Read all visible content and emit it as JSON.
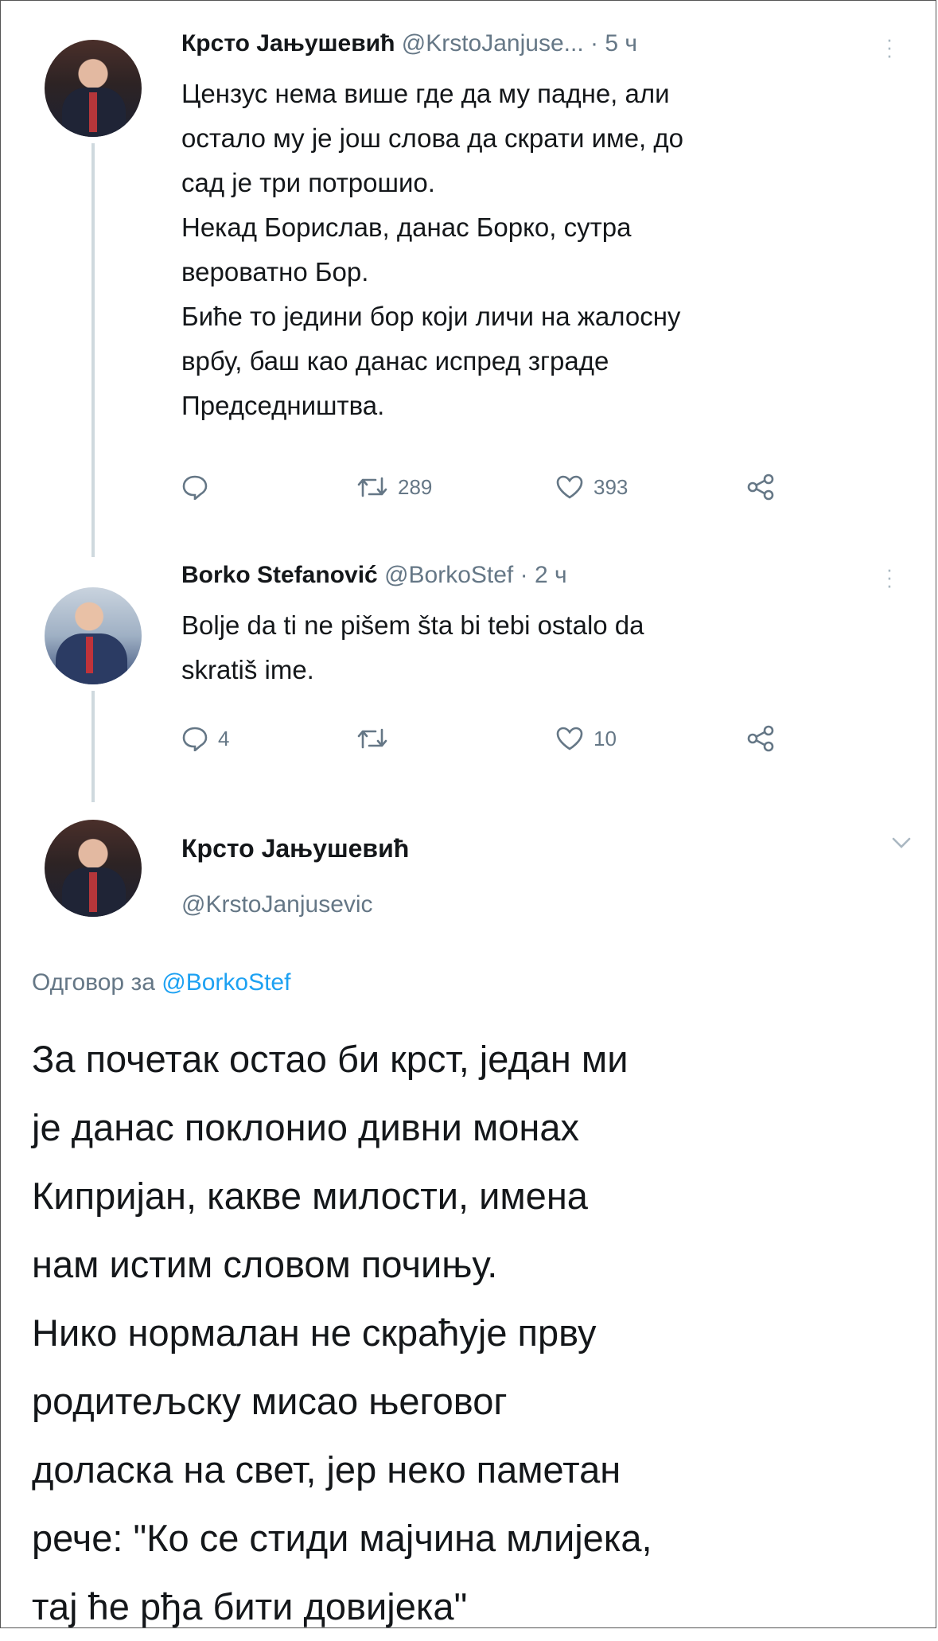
{
  "tweet1": {
    "name": "Крсто Јањушевић",
    "handle": "@KrstoJanjuse...",
    "dot": "·",
    "time": "5 ч",
    "lines": [
      "Цензус нема више где да му падне, али",
      "остало му је још слова да скрати име, до",
      "сад је три потрошио.",
      "Некад Борислав, данас Борко, сутра",
      "вероватно Бор.",
      "Биће то једини бор који личи на жалосну",
      "врбу, баш као данас испред зграде",
      "Председништва."
    ],
    "retweets": "289",
    "likes": "393"
  },
  "tweet2": {
    "name": "Borko Stefanović",
    "handle": "@BorkoStef",
    "dot": "·",
    "time": "2 ч",
    "lines": [
      "Bolje da ti ne pišem šta bi tebi ostalo da",
      "skratiš ime."
    ],
    "replies": "4",
    "likes": "10"
  },
  "tweet3": {
    "name": "Крсто Јањушевић",
    "handle": "@KrstoJanjusevic",
    "reply_prefix": "Одговор за",
    "reply_mention": "@BorkoStef",
    "lines": [
      "За почетак остао би крст, један ми",
      "је данас поклонио дивни монах",
      "Кипријан, какве милости, имена",
      "нам истим словом почињу.",
      "Нико нормалан не скраћује прву",
      "родитељску мисао његовог",
      "доласка на свет, јер неко паметан",
      "рече: \"Ко се стиди мајчина млијека,",
      "тај ће рђа бити довијека\""
    ]
  },
  "colors": {
    "link": "#1da1f2",
    "muted": "#657786",
    "thread": "#cfd9de"
  }
}
